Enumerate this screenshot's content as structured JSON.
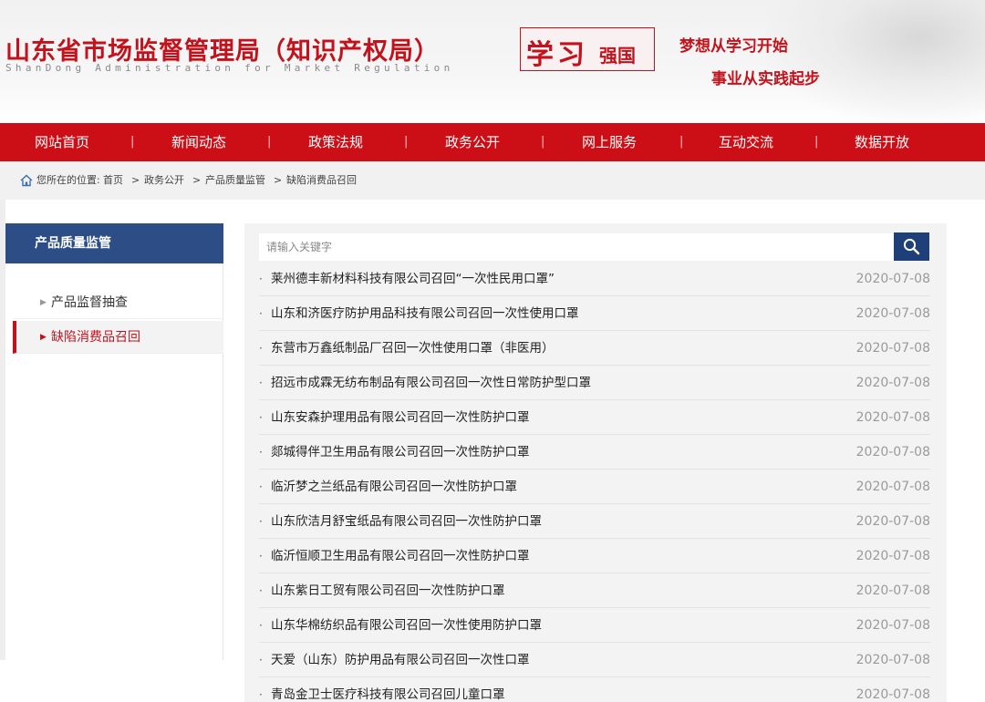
{
  "header": {
    "title": "山东省市场监督管理局（知识产权局）",
    "subtitle": "ShanDong Administration for Market Regulation",
    "logo_big": "学习",
    "logo_small": "强国",
    "slogan_line1": "梦想从学习开始",
    "slogan_line2": "事业从实践起步",
    "brand_color": "#c4121c"
  },
  "nav": {
    "items": [
      "网站首页",
      "新闻动态",
      "政策法规",
      "政务公开",
      "网上服务",
      "互动交流",
      "数据开放"
    ],
    "separator": "|",
    "background": "#cc0e16"
  },
  "breadcrumb": {
    "prefix": "您所在的位置:",
    "items": [
      "首页",
      "政务公开",
      "产品质量监管",
      "缺陷消费品召回"
    ],
    "separator": ">"
  },
  "sidebar": {
    "heading": "产品质量监管",
    "items": [
      {
        "label": "产品监督抽查",
        "active": false
      },
      {
        "label": "缺陷消费品召回",
        "active": true
      }
    ]
  },
  "search": {
    "placeholder": "请输入关键字"
  },
  "list": {
    "bullet": "·",
    "rows": [
      {
        "title": "莱州德丰新材料科技有限公司召回“一次性民用口罩”",
        "date": "2020-07-08"
      },
      {
        "title": "山东和济医疗防护用品科技有限公司召回一次性使用口罩",
        "date": "2020-07-08"
      },
      {
        "title": "东营市万鑫纸制品厂召回一次性使用口罩（非医用）",
        "date": "2020-07-08"
      },
      {
        "title": "招远市成霖无纺布制品有限公司召回一次性日常防护型口罩",
        "date": "2020-07-08"
      },
      {
        "title": "山东安森护理用品有限公司召回一次性防护口罩",
        "date": "2020-07-08"
      },
      {
        "title": "郯城得伴卫生用品有限公司召回一次性防护口罩",
        "date": "2020-07-08"
      },
      {
        "title": "临沂梦之兰纸品有限公司召回一次性防护口罩",
        "date": "2020-07-08"
      },
      {
        "title": "山东欣洁月舒宝纸品有限公司召回一次性防护口罩",
        "date": "2020-07-08"
      },
      {
        "title": "临沂恒顺卫生用品有限公司召回一次性防护口罩",
        "date": "2020-07-08"
      },
      {
        "title": "山东紫日工贸有限公司召回一次性防护口罩",
        "date": "2020-07-08"
      },
      {
        "title": "山东华棉纺织品有限公司召回一次性使用防护口罩",
        "date": "2020-07-08"
      },
      {
        "title": "天爱（山东）防护用品有限公司召回一次性口罩",
        "date": "2020-07-08"
      },
      {
        "title": "青岛金卫士医疗科技有限公司召回儿童口罩",
        "date": "2020-07-08"
      }
    ]
  }
}
